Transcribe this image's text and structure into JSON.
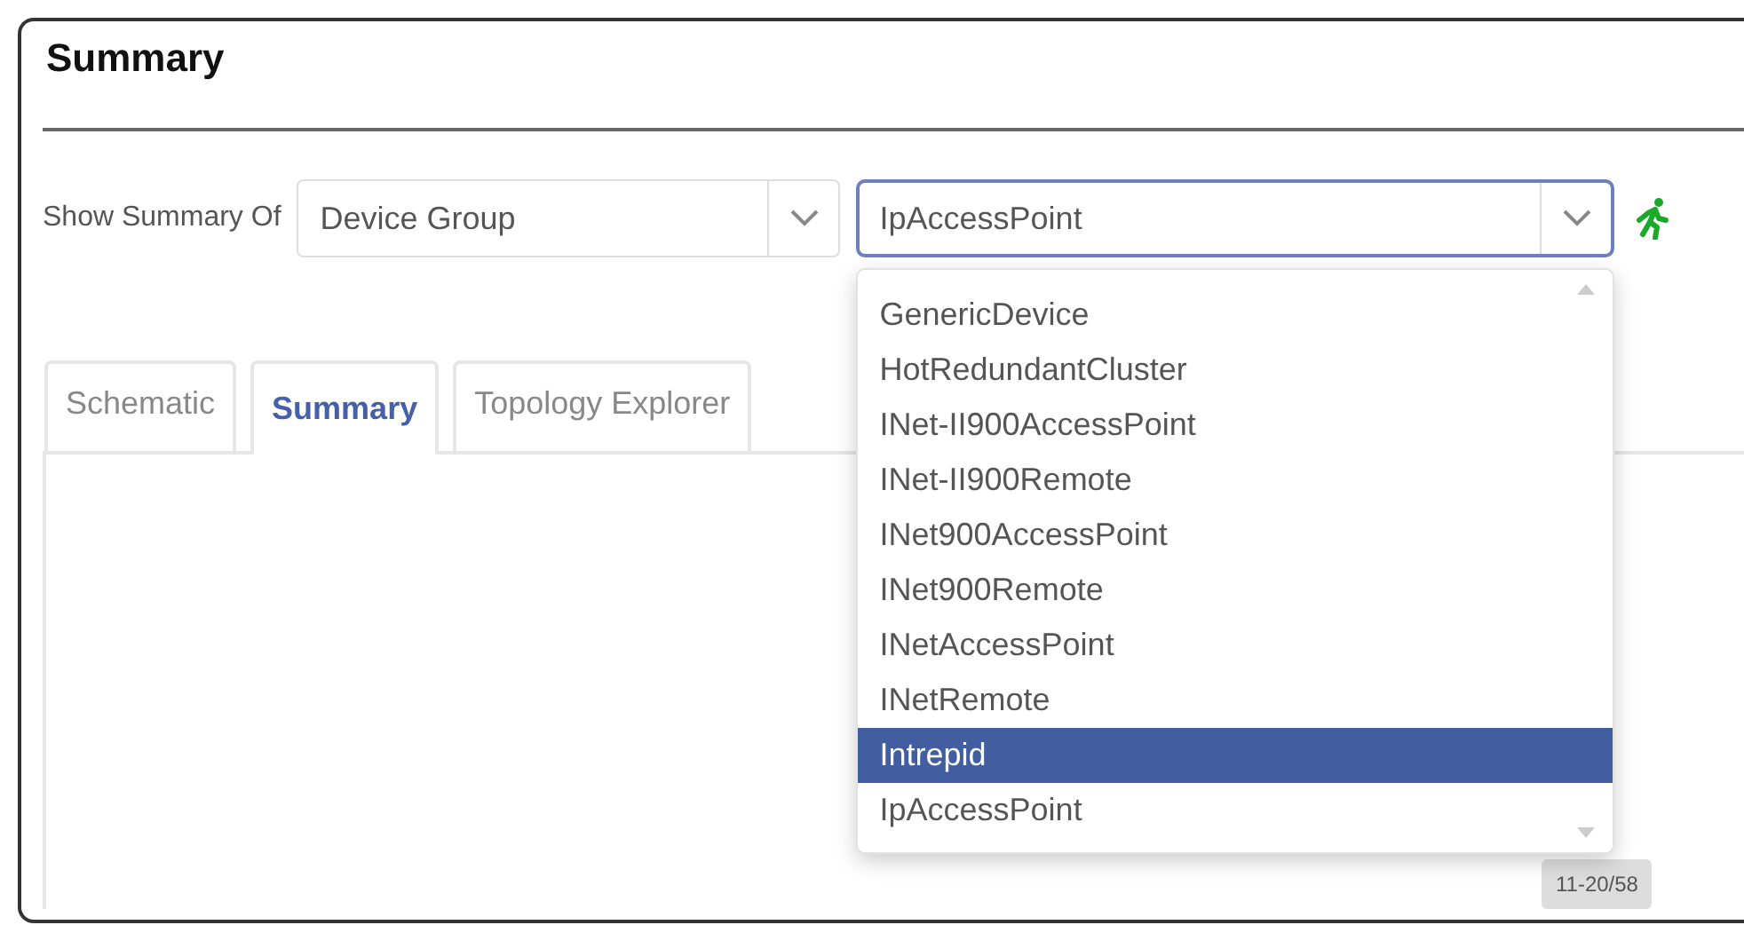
{
  "title": "Summary",
  "filter": {
    "label": "Show Summary Of",
    "group_select": {
      "value": "Device Group"
    },
    "type_combo": {
      "value": "IpAccessPoint",
      "focused": true
    },
    "options": [
      {
        "label": "GenericDevice",
        "selected": false
      },
      {
        "label": "HotRedundantCluster",
        "selected": false
      },
      {
        "label": "INet-II900AccessPoint",
        "selected": false
      },
      {
        "label": "INet-II900Remote",
        "selected": false
      },
      {
        "label": "INet900AccessPoint",
        "selected": false
      },
      {
        "label": "INet900Remote",
        "selected": false
      },
      {
        "label": "INetAccessPoint",
        "selected": false
      },
      {
        "label": "INetRemote",
        "selected": false
      },
      {
        "label": "Intrepid",
        "selected": true
      },
      {
        "label": "IpAccessPoint",
        "selected": false
      }
    ]
  },
  "tabs": [
    {
      "label": "Schematic",
      "selected": false
    },
    {
      "label": "Summary",
      "selected": true
    },
    {
      "label": "Topology Explorer",
      "selected": false
    }
  ],
  "pager": "11-20/58"
}
